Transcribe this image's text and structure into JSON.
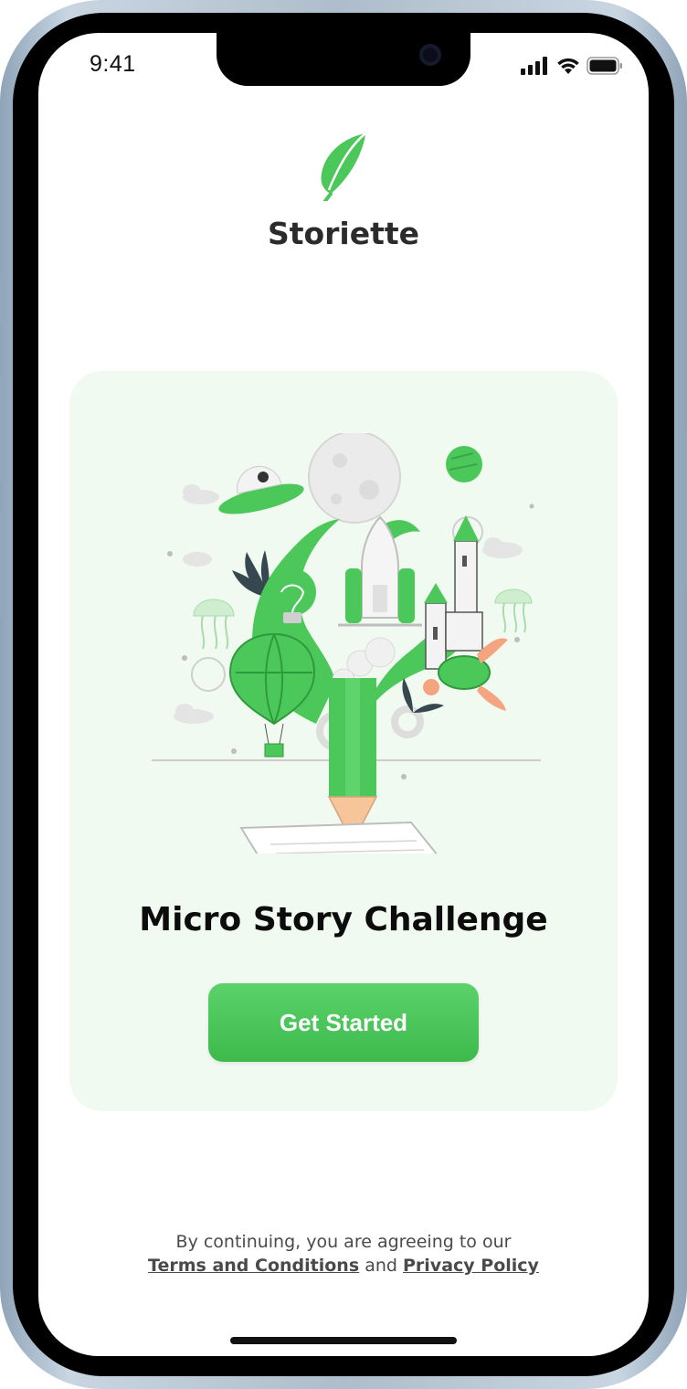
{
  "status_bar": {
    "time": "9:41"
  },
  "app": {
    "brand_name": "Storiette"
  },
  "hero": {
    "title": "Micro Story Challenge",
    "cta_label": "Get Started"
  },
  "legal": {
    "prefix": "By continuing, you are agreeing to our",
    "terms_label": "Terms and Conditions",
    "conjunction": "and",
    "privacy_label": "Privacy Policy"
  },
  "colors": {
    "accent": "#4CC85A",
    "card_bg": "#F1FAF1",
    "text_dark": "#2B2B2B"
  },
  "icons": [
    "feather-logo-icon",
    "signal-icon",
    "wifi-icon",
    "battery-icon"
  ]
}
